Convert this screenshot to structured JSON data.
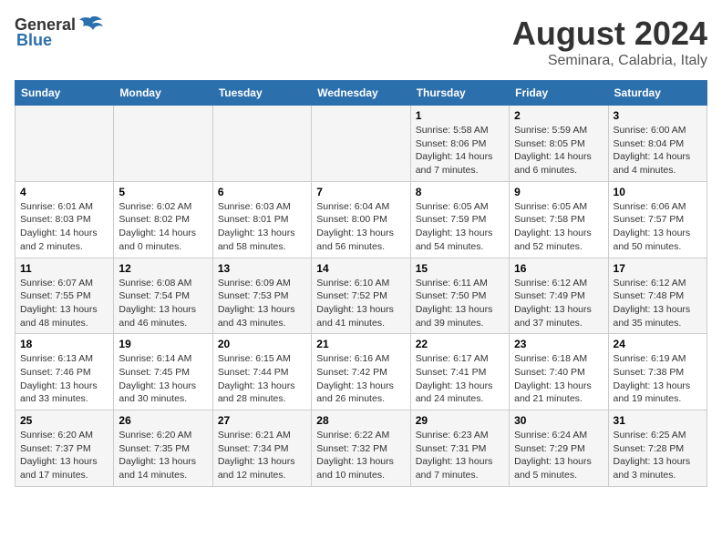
{
  "header": {
    "logo_general": "General",
    "logo_blue": "Blue",
    "main_title": "August 2024",
    "subtitle": "Seminara, Calabria, Italy"
  },
  "days_of_week": [
    "Sunday",
    "Monday",
    "Tuesday",
    "Wednesday",
    "Thursday",
    "Friday",
    "Saturday"
  ],
  "weeks": [
    [
      {
        "day": "",
        "info": ""
      },
      {
        "day": "",
        "info": ""
      },
      {
        "day": "",
        "info": ""
      },
      {
        "day": "",
        "info": ""
      },
      {
        "day": "1",
        "info": "Sunrise: 5:58 AM\nSunset: 8:06 PM\nDaylight: 14 hours and 7 minutes."
      },
      {
        "day": "2",
        "info": "Sunrise: 5:59 AM\nSunset: 8:05 PM\nDaylight: 14 hours and 6 minutes."
      },
      {
        "day": "3",
        "info": "Sunrise: 6:00 AM\nSunset: 8:04 PM\nDaylight: 14 hours and 4 minutes."
      }
    ],
    [
      {
        "day": "4",
        "info": "Sunrise: 6:01 AM\nSunset: 8:03 PM\nDaylight: 14 hours and 2 minutes."
      },
      {
        "day": "5",
        "info": "Sunrise: 6:02 AM\nSunset: 8:02 PM\nDaylight: 14 hours and 0 minutes."
      },
      {
        "day": "6",
        "info": "Sunrise: 6:03 AM\nSunset: 8:01 PM\nDaylight: 13 hours and 58 minutes."
      },
      {
        "day": "7",
        "info": "Sunrise: 6:04 AM\nSunset: 8:00 PM\nDaylight: 13 hours and 56 minutes."
      },
      {
        "day": "8",
        "info": "Sunrise: 6:05 AM\nSunset: 7:59 PM\nDaylight: 13 hours and 54 minutes."
      },
      {
        "day": "9",
        "info": "Sunrise: 6:05 AM\nSunset: 7:58 PM\nDaylight: 13 hours and 52 minutes."
      },
      {
        "day": "10",
        "info": "Sunrise: 6:06 AM\nSunset: 7:57 PM\nDaylight: 13 hours and 50 minutes."
      }
    ],
    [
      {
        "day": "11",
        "info": "Sunrise: 6:07 AM\nSunset: 7:55 PM\nDaylight: 13 hours and 48 minutes."
      },
      {
        "day": "12",
        "info": "Sunrise: 6:08 AM\nSunset: 7:54 PM\nDaylight: 13 hours and 46 minutes."
      },
      {
        "day": "13",
        "info": "Sunrise: 6:09 AM\nSunset: 7:53 PM\nDaylight: 13 hours and 43 minutes."
      },
      {
        "day": "14",
        "info": "Sunrise: 6:10 AM\nSunset: 7:52 PM\nDaylight: 13 hours and 41 minutes."
      },
      {
        "day": "15",
        "info": "Sunrise: 6:11 AM\nSunset: 7:50 PM\nDaylight: 13 hours and 39 minutes."
      },
      {
        "day": "16",
        "info": "Sunrise: 6:12 AM\nSunset: 7:49 PM\nDaylight: 13 hours and 37 minutes."
      },
      {
        "day": "17",
        "info": "Sunrise: 6:12 AM\nSunset: 7:48 PM\nDaylight: 13 hours and 35 minutes."
      }
    ],
    [
      {
        "day": "18",
        "info": "Sunrise: 6:13 AM\nSunset: 7:46 PM\nDaylight: 13 hours and 33 minutes."
      },
      {
        "day": "19",
        "info": "Sunrise: 6:14 AM\nSunset: 7:45 PM\nDaylight: 13 hours and 30 minutes."
      },
      {
        "day": "20",
        "info": "Sunrise: 6:15 AM\nSunset: 7:44 PM\nDaylight: 13 hours and 28 minutes."
      },
      {
        "day": "21",
        "info": "Sunrise: 6:16 AM\nSunset: 7:42 PM\nDaylight: 13 hours and 26 minutes."
      },
      {
        "day": "22",
        "info": "Sunrise: 6:17 AM\nSunset: 7:41 PM\nDaylight: 13 hours and 24 minutes."
      },
      {
        "day": "23",
        "info": "Sunrise: 6:18 AM\nSunset: 7:40 PM\nDaylight: 13 hours and 21 minutes."
      },
      {
        "day": "24",
        "info": "Sunrise: 6:19 AM\nSunset: 7:38 PM\nDaylight: 13 hours and 19 minutes."
      }
    ],
    [
      {
        "day": "25",
        "info": "Sunrise: 6:20 AM\nSunset: 7:37 PM\nDaylight: 13 hours and 17 minutes."
      },
      {
        "day": "26",
        "info": "Sunrise: 6:20 AM\nSunset: 7:35 PM\nDaylight: 13 hours and 14 minutes."
      },
      {
        "day": "27",
        "info": "Sunrise: 6:21 AM\nSunset: 7:34 PM\nDaylight: 13 hours and 12 minutes."
      },
      {
        "day": "28",
        "info": "Sunrise: 6:22 AM\nSunset: 7:32 PM\nDaylight: 13 hours and 10 minutes."
      },
      {
        "day": "29",
        "info": "Sunrise: 6:23 AM\nSunset: 7:31 PM\nDaylight: 13 hours and 7 minutes."
      },
      {
        "day": "30",
        "info": "Sunrise: 6:24 AM\nSunset: 7:29 PM\nDaylight: 13 hours and 5 minutes."
      },
      {
        "day": "31",
        "info": "Sunrise: 6:25 AM\nSunset: 7:28 PM\nDaylight: 13 hours and 3 minutes."
      }
    ]
  ]
}
